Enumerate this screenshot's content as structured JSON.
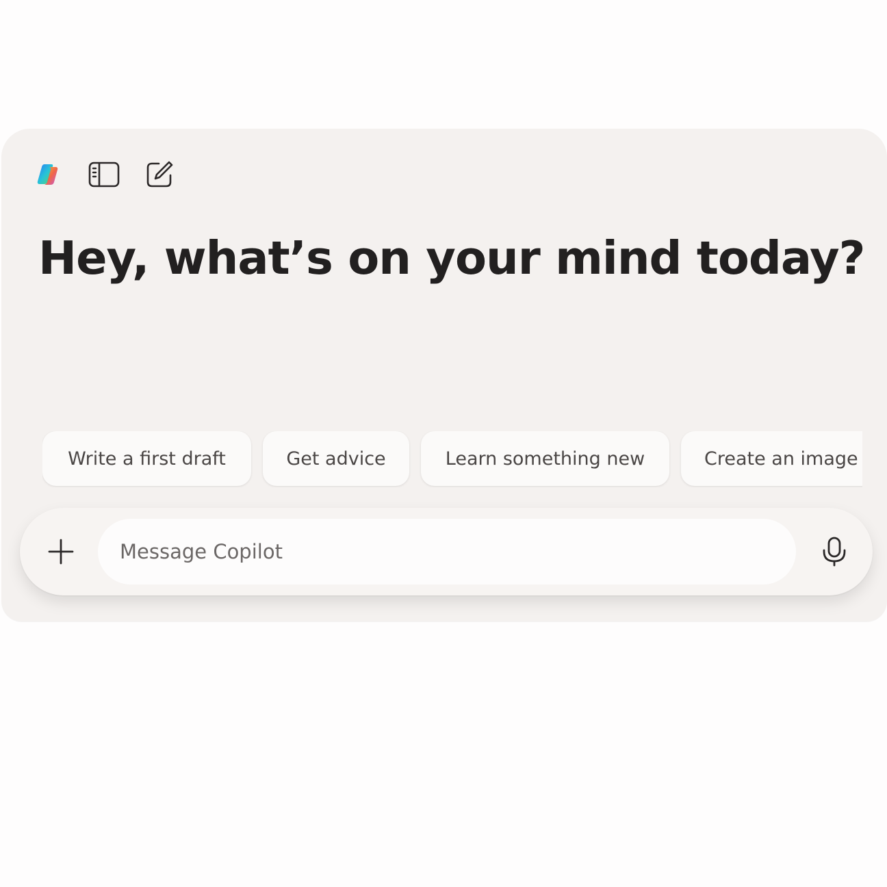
{
  "toolbar": {
    "logo_icon": "copilot-logo-icon",
    "sidebar_icon": "sidebar-toggle-icon",
    "new_chat_icon": "compose-icon"
  },
  "greeting": "Hey, what’s on your mind today?",
  "suggestions": [
    "Write a first draft",
    "Get advice",
    "Learn something new",
    "Create an image"
  ],
  "composer": {
    "add_icon": "plus-icon",
    "placeholder": "Message Copilot",
    "mic_icon": "microphone-icon"
  },
  "colors": {
    "page_background": "#fefdfd",
    "window_background": "#f4f1ef",
    "heading_text": "#222020",
    "chip_text": "#4a4645"
  }
}
